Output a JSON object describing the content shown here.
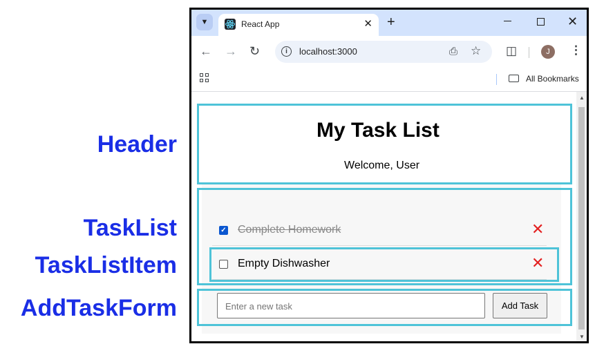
{
  "labels": {
    "header": "Header",
    "task_list": "TaskList",
    "task_list_item": "TaskListItem",
    "add_task_form": "AddTaskForm"
  },
  "browser": {
    "tab_title": "React App",
    "url": "localhost:3000",
    "avatar_initial": "J",
    "bookmarks_label": "All Bookmarks"
  },
  "app": {
    "title": "My Task List",
    "subtitle": "Welcome, User",
    "tasks": [
      {
        "text": "Complete Homework",
        "done": true
      },
      {
        "text": "Empty Dishwasher",
        "done": false
      }
    ],
    "input_placeholder": "Enter a new task",
    "add_button_label": "Add Task"
  },
  "colors": {
    "label_text": "#1a2ee6",
    "component_outline": "#4ec3d8",
    "delete_icon": "#e32020",
    "checkbox_checked": "#0b57d0",
    "tabbar": "#d3e3fd"
  },
  "icons": {
    "tab_dropdown": "chevron-down-icon",
    "favicon": "react-icon",
    "tab_close": "close-icon",
    "new_tab": "plus-icon",
    "back": "arrow-left-icon",
    "forward": "arrow-right-icon",
    "reload": "reload-icon",
    "site_info": "info-icon",
    "install": "install-icon",
    "bookmark": "star-icon",
    "extensions": "puzzle-icon",
    "menu": "kebab-menu-icon",
    "apps": "apps-grid-icon",
    "folder": "folder-icon",
    "delete": "x-icon"
  }
}
